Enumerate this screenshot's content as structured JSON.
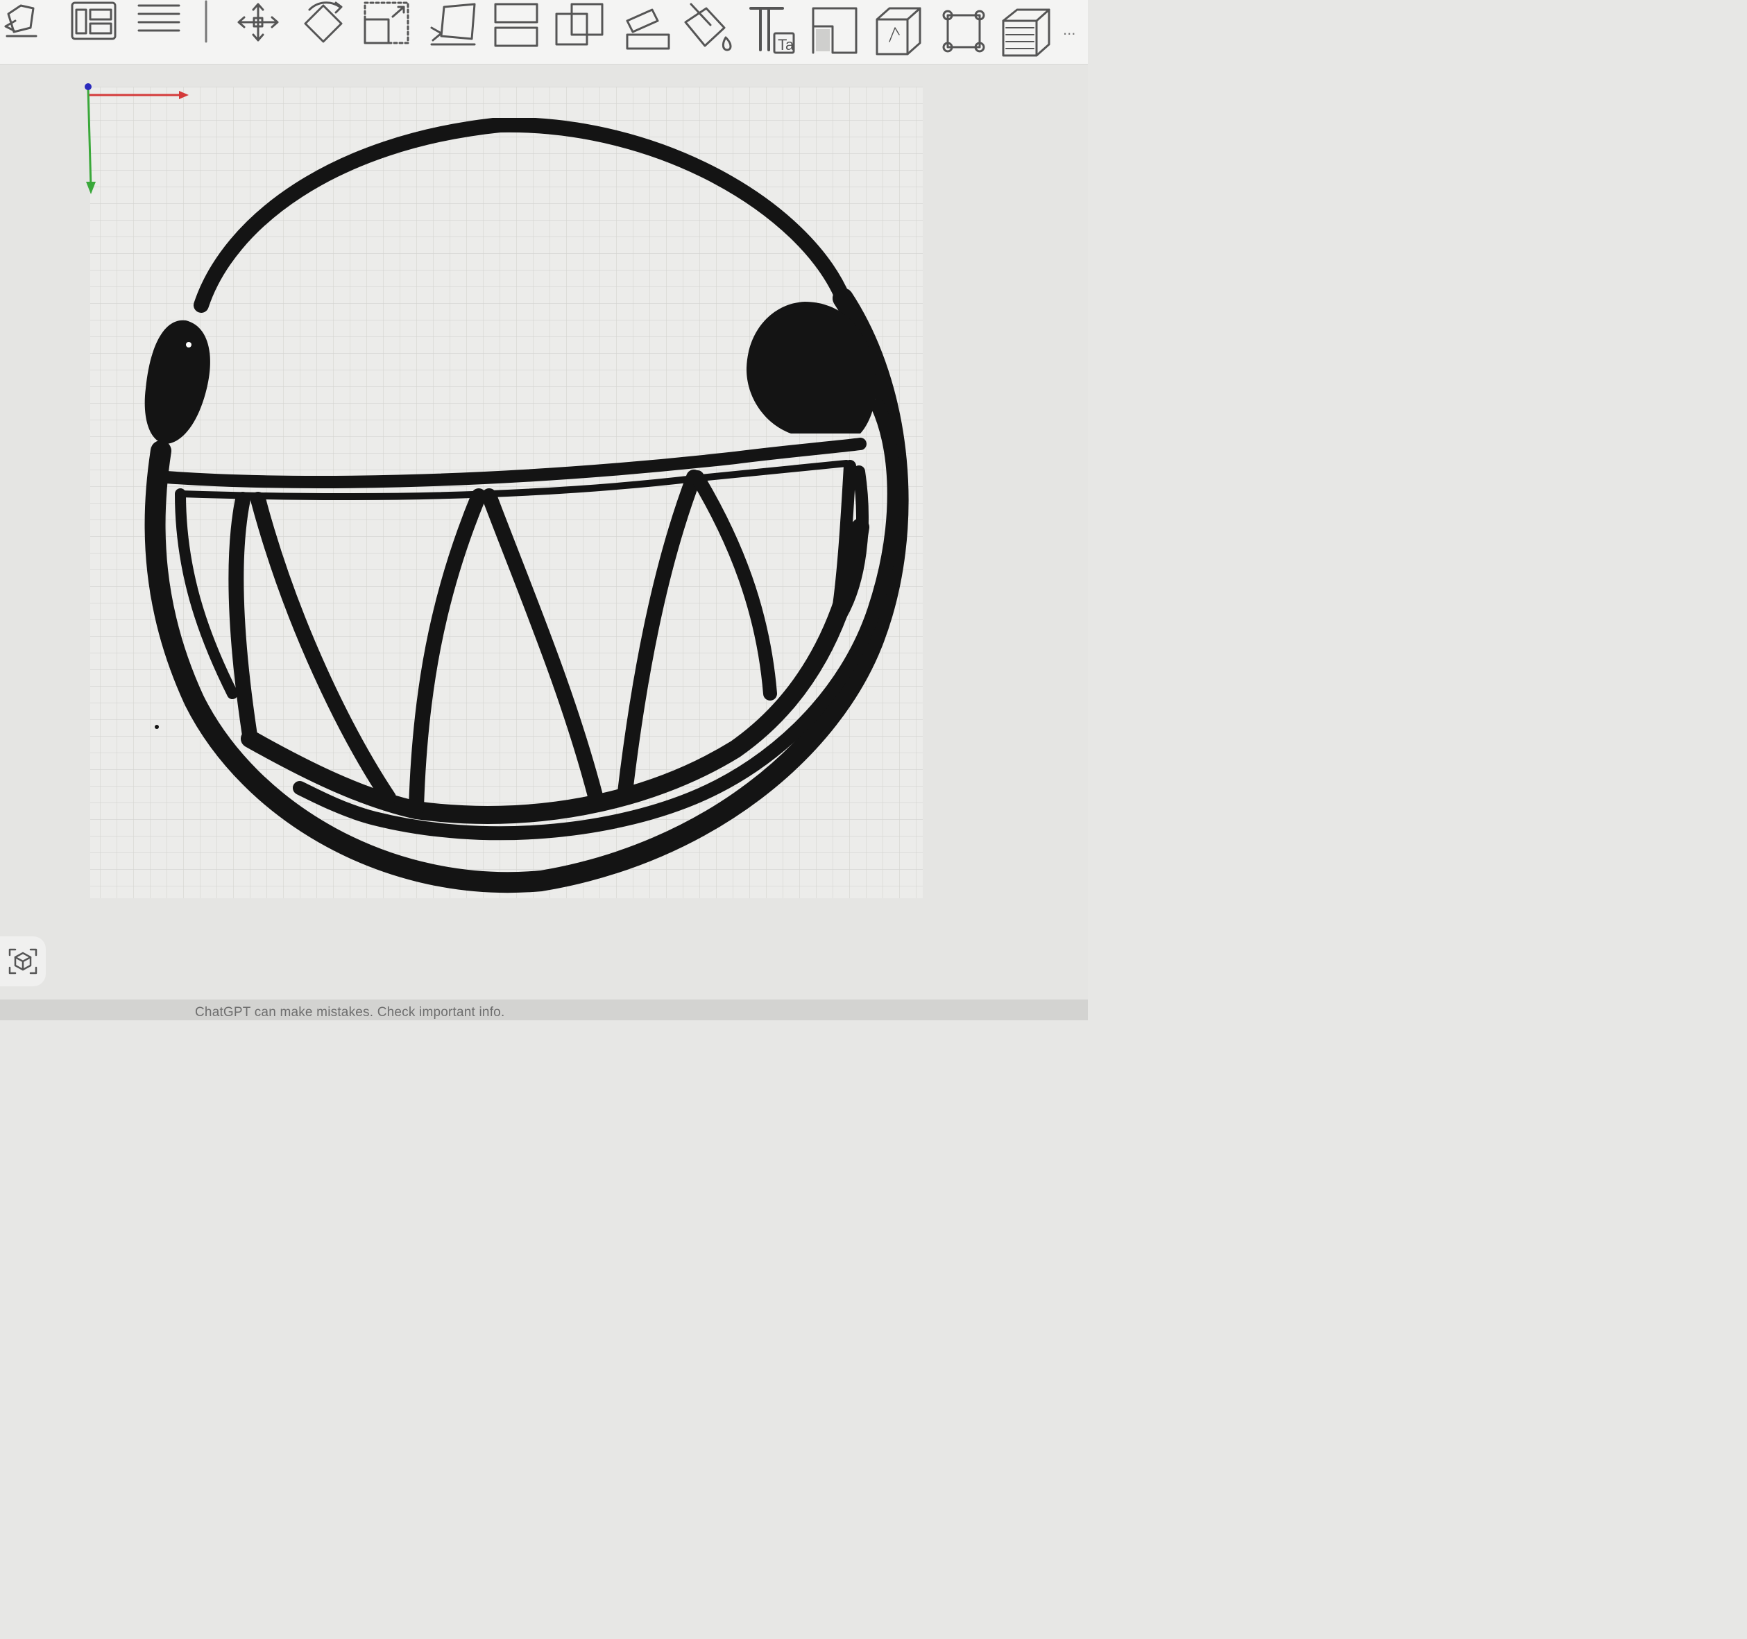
{
  "toolbar": {
    "tools": [
      {
        "id": "auto-select",
        "icon": "auto-select-icon"
      },
      {
        "id": "layout",
        "icon": "layout-panels-icon"
      },
      {
        "id": "align-lines",
        "icon": "align-lines-icon"
      },
      {
        "id": "move",
        "icon": "move-arrows-icon"
      },
      {
        "id": "rotate",
        "icon": "rotate-icon"
      },
      {
        "id": "scale",
        "icon": "scale-icon"
      },
      {
        "id": "mirror",
        "icon": "mirror-icon"
      },
      {
        "id": "split",
        "icon": "split-icon"
      },
      {
        "id": "boolean",
        "icon": "boolean-overlap-icon"
      },
      {
        "id": "place-on-face",
        "icon": "place-on-face-icon"
      },
      {
        "id": "paint-bucket",
        "icon": "paint-bucket-icon"
      },
      {
        "id": "text",
        "icon": "text-icon",
        "label": "Ta"
      },
      {
        "id": "cut-corner",
        "icon": "cut-corner-icon"
      },
      {
        "id": "solid",
        "icon": "solid-box-icon"
      },
      {
        "id": "fit-frame",
        "icon": "fit-frame-icon"
      },
      {
        "id": "texture",
        "icon": "texture-box-icon"
      }
    ],
    "more_label": "..."
  },
  "canvas": {
    "grid_color": "#d9d9d6",
    "x_axis_color": "#d43a3a",
    "y_axis_color": "#3aa83a",
    "origin_color": "#2b2bbd",
    "shape_fill": "#141414",
    "subject": "grinning-face-cut-design"
  },
  "footer": {
    "disclaimer": "ChatGPT can make mistakes. Check important info."
  }
}
